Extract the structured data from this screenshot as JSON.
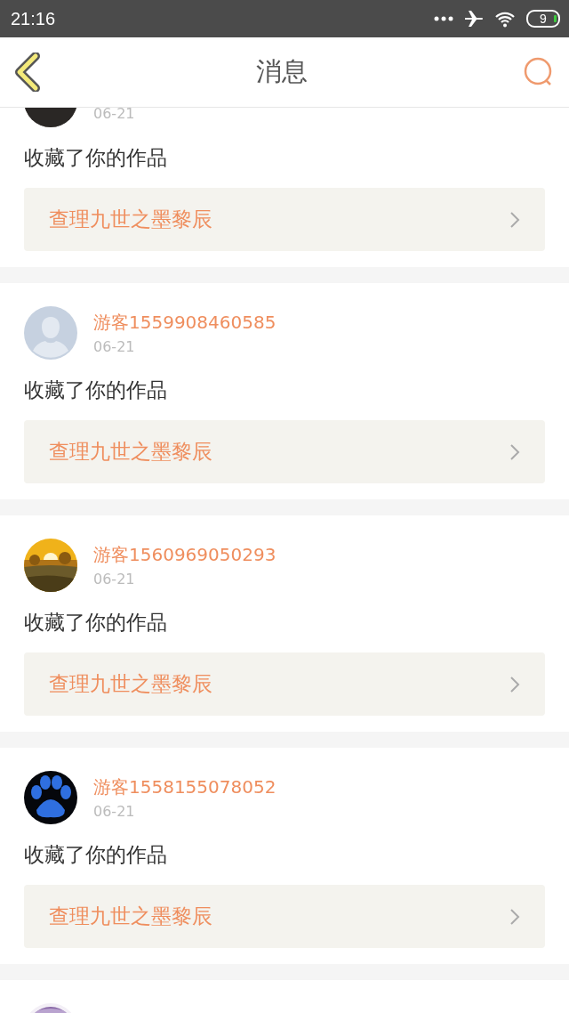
{
  "status_bar": {
    "time": "21:16",
    "battery": "9"
  },
  "header": {
    "title": "消息"
  },
  "messages": [
    {
      "avatar": {
        "kind": "picture"
      },
      "date": "06-21",
      "action": "收藏了你的作品",
      "work": "查理九世之墨黎辰"
    },
    {
      "avatar": {
        "kind": "default"
      },
      "username": "游客1559908460585",
      "date": "06-21",
      "action": "收藏了你的作品",
      "work": "查理九世之墨黎辰"
    },
    {
      "avatar": {
        "kind": "picture"
      },
      "username": "游客1560969050293",
      "date": "06-21",
      "action": "收藏了你的作品",
      "work": "查理九世之墨黎辰"
    },
    {
      "avatar": {
        "kind": "picture"
      },
      "username": "游客1558155078052",
      "date": "06-21",
      "action": "收藏了你的作品",
      "work": "查理九世之墨黎辰"
    },
    {
      "avatar": {
        "kind": "picture"
      }
    }
  ]
}
